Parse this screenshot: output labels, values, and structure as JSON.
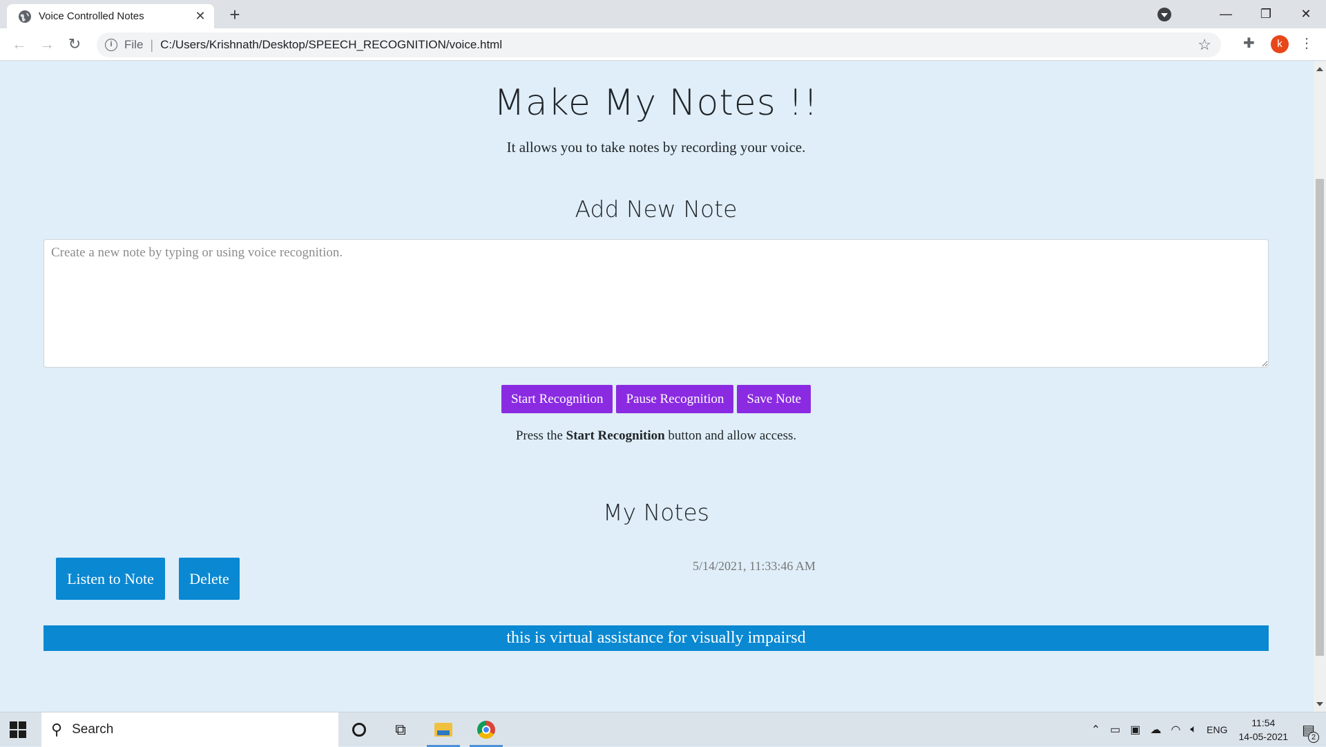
{
  "browser": {
    "tab_title": "Voice Controlled Notes",
    "tab_close": "✕",
    "new_tab": "+",
    "url_scheme_label": "File",
    "url": "C:/Users/Krishnath/Desktop/SPEECH_RECOGNITION/voice.html",
    "profile_initial": "k",
    "window_minimize": "—",
    "window_restore": "❐",
    "window_close": "✕"
  },
  "page": {
    "title": "Make My Notes !!",
    "subtitle": "It allows you to take notes by recording your voice.",
    "add_heading": "Add New Note",
    "textarea_placeholder": "Create a new note by typing or using voice recognition.",
    "buttons": {
      "start": "Start Recognition",
      "pause": "Pause Recognition",
      "save": "Save Note"
    },
    "hint_prefix": "Press the ",
    "hint_bold": "Start Recognition",
    "hint_suffix": " button and allow access.",
    "notes_heading": "My Notes",
    "notes": [
      {
        "listen_label": "Listen to Note",
        "delete_label": "Delete",
        "date": "5/14/2021, 11:33:46 AM",
        "content": "this is virtual assistance for visually impairsd"
      }
    ]
  },
  "taskbar": {
    "search_label": "Search",
    "language": "ENG",
    "time": "11:54",
    "date": "14-05-2021",
    "notification_count": "2"
  },
  "colors": {
    "page_background": "#dfeef8",
    "purple_button": "#8a2be2",
    "blue_button": "#0a88d2"
  }
}
